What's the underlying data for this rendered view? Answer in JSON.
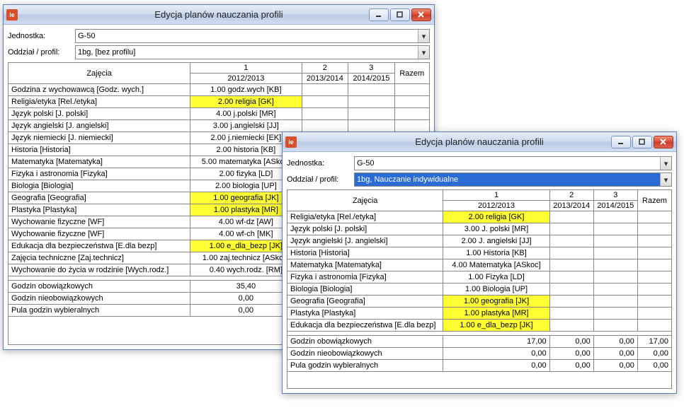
{
  "window1": {
    "title": "Edycja planów nauczania profili",
    "unit_label": "Jednostka:",
    "unit_value": "G-50",
    "profile_label": "Oddział / profil:",
    "profile_value": "1bg, [bez profilu]",
    "headers": {
      "subject": "Zajęcia",
      "col1_num": "1",
      "col1_year": "2012/2013",
      "col2_num": "2",
      "col2_year": "2013/2014",
      "col3_num": "3",
      "col3_year": "2014/2015",
      "total": "Razem"
    },
    "rows": [
      {
        "subj": "Godzina z wychowawcą [Godz. wych.]",
        "v": "1.00 godz.wych [KB]",
        "hl": false
      },
      {
        "subj": "Religia/etyka [Rel./etyka]",
        "v": "2.00 religia [GK]",
        "hl": true
      },
      {
        "subj": "Język polski [J. polski]",
        "v": "4.00 j.polski [MR]",
        "hl": false
      },
      {
        "subj": "Język angielski [J. angielski]",
        "v": "3.00 j.angielski [JJ]",
        "hl": false
      },
      {
        "subj": "Język niemiecki [J. niemiecki]",
        "v": "2.00 j.niemiecki [EK]",
        "hl": false
      },
      {
        "subj": "Historia [Historia]",
        "v": "2.00 historia [KB]",
        "hl": false
      },
      {
        "subj": "Matematyka [Matematyka]",
        "v": "5.00 matematyka [ASkoc]",
        "hl": false
      },
      {
        "subj": "Fizyka i astronomia [Fizyka]",
        "v": "2.00 fizyka [LD]",
        "hl": false
      },
      {
        "subj": "Biologia [Biologia]",
        "v": "2.00 biologia [UP]",
        "hl": false
      },
      {
        "subj": "Geografia [Geografia]",
        "v": "1.00 geografia [JK]",
        "hl": true
      },
      {
        "subj": "Plastyka [Plastyka]",
        "v": "1.00 plastyka [MR]",
        "hl": true
      },
      {
        "subj": "Wychowanie fizyczne [WF]",
        "v": "4.00 wf-dz [AW]",
        "hl": false
      },
      {
        "subj": "Wychowanie fizyczne [WF]",
        "v": "4.00 wf-ch [MK]",
        "hl": false
      },
      {
        "subj": "Edukacja dla bezpieczeństwa [E.dla bezp]",
        "v": "1.00 e_dla_bezp [JK]",
        "hl": true
      },
      {
        "subj": "Zajęcia techniczne [Zaj.technicz]",
        "v": "1.00 zaj.technicz [ASkoc]",
        "hl": false
      },
      {
        "subj": "Wychowanie do życia w rodzinie [Wych.rodz.]",
        "v": "0.40 wych.rodz. [RM]",
        "hl": false
      }
    ],
    "summary": [
      {
        "label": "Godzin obowiązkowych",
        "v": "35,40"
      },
      {
        "label": "Godzin nieobowiązkowych",
        "v": "0,00"
      },
      {
        "label": "Pula godzin wybieralnych",
        "v": "0,00"
      }
    ]
  },
  "window2": {
    "title": "Edycja planów nauczania profili",
    "unit_label": "Jednostka:",
    "unit_value": "G-50",
    "profile_label": "Oddział / profil:",
    "profile_value": "1bg, Nauczanie indywidualne",
    "headers": {
      "subject": "Zajęcia",
      "col1_num": "1",
      "col1_year": "2012/2013",
      "col2_num": "2",
      "col2_year": "2013/2014",
      "col3_num": "3",
      "col3_year": "2014/2015",
      "total": "Razem"
    },
    "rows": [
      {
        "subj": "Religia/etyka [Rel./etyka]",
        "v": "2.00 religia [GK]",
        "hl": true
      },
      {
        "subj": "Język polski [J. polski]",
        "v": "3.00 J. polski [MR]",
        "hl": false
      },
      {
        "subj": "Język angielski [J. angielski]",
        "v": "2.00 J. angielski [JJ]",
        "hl": false
      },
      {
        "subj": "Historia [Historia]",
        "v": "1.00 Historia [KB]",
        "hl": false
      },
      {
        "subj": "Matematyka [Matematyka]",
        "v": "4.00 Matematyka [ASkoc]",
        "hl": false
      },
      {
        "subj": "Fizyka i astronomia [Fizyka]",
        "v": "1.00 Fizyka [LD]",
        "hl": false
      },
      {
        "subj": "Biologia [Biologia]",
        "v": "1.00 Biologia [UP]",
        "hl": false
      },
      {
        "subj": "Geografia [Geografia]",
        "v": "1.00 geografia [JK]",
        "hl": true
      },
      {
        "subj": "Plastyka [Plastyka]",
        "v": "1.00 plastyka [MR]",
        "hl": true
      },
      {
        "subj": "Edukacja dla bezpieczeństwa [E.dla bezp]",
        "v": "1.00 e_dla_bezp [JK]",
        "hl": true
      }
    ],
    "summary": [
      {
        "label": "Godzin obowiązkowych",
        "v1": "17,00",
        "v2": "0,00",
        "v3": "0,00",
        "vt": "17,00"
      },
      {
        "label": "Godzin nieobowiązkowych",
        "v1": "0,00",
        "v2": "0,00",
        "v3": "0,00",
        "vt": "0,00"
      },
      {
        "label": "Pula godzin wybieralnych",
        "v1": "0,00",
        "v2": "0,00",
        "v3": "0,00",
        "vt": "0,00"
      }
    ]
  }
}
